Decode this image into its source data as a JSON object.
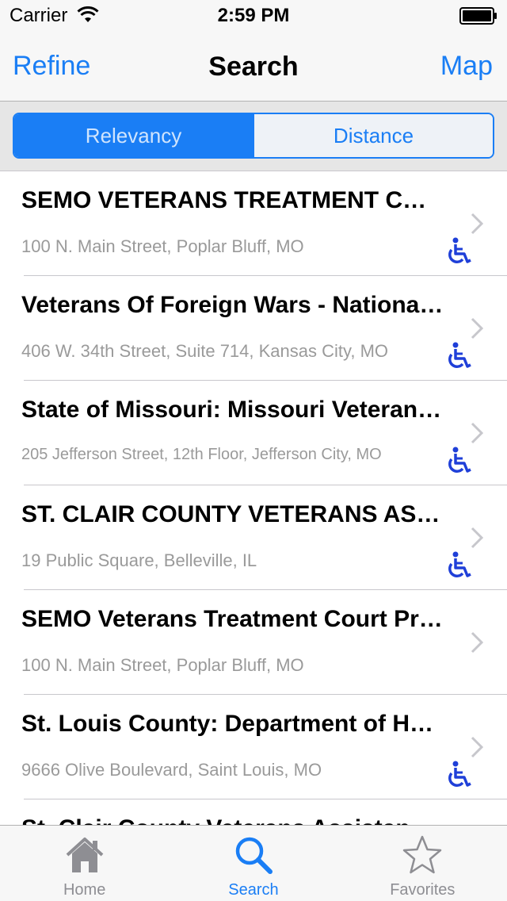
{
  "status_bar": {
    "carrier": "Carrier",
    "time": "2:59 PM"
  },
  "nav": {
    "left_label": "Refine",
    "title": "Search",
    "right_label": "Map"
  },
  "segments": {
    "items": [
      "Relevancy",
      "Distance"
    ],
    "selected": "Relevancy"
  },
  "results": [
    {
      "name": "SEMO VETERANS TREATMENT C…",
      "address": "100 N. Main Street, Poplar Bluff, MO",
      "accessible": true
    },
    {
      "name": "Veterans Of Foreign Wars - Nationa…",
      "address": "406 W. 34th Street, Suite 714, Kansas City, MO",
      "accessible": true
    },
    {
      "name": "State of Missouri: Missouri Veteran…",
      "address": "205 Jefferson Street, 12th Floor, Jefferson City, MO",
      "accessible": true
    },
    {
      "name": "ST. CLAIR COUNTY VETERANS AS…",
      "address": "19 Public Square, Belleville, IL",
      "accessible": true
    },
    {
      "name": "SEMO Veterans Treatment Court Pr…",
      "address": "100 N. Main Street, Poplar Bluff, MO",
      "accessible": false
    },
    {
      "name": "St. Louis County: Department of H…",
      "address": "9666 Olive Boulevard, Saint Louis, MO",
      "accessible": true
    },
    {
      "name": "St. Clair County Veterans Assistan…",
      "address": "",
      "accessible": false
    }
  ],
  "tabs": [
    {
      "label": "Home",
      "icon": "home-icon",
      "active": false
    },
    {
      "label": "Search",
      "icon": "search-icon",
      "active": true
    },
    {
      "label": "Favorites",
      "icon": "star-icon",
      "active": false
    }
  ],
  "colors": {
    "accent": "#1a7ef5",
    "accessibility_icon": "#1f3fd8",
    "secondary_text": "#9a9a9a"
  }
}
